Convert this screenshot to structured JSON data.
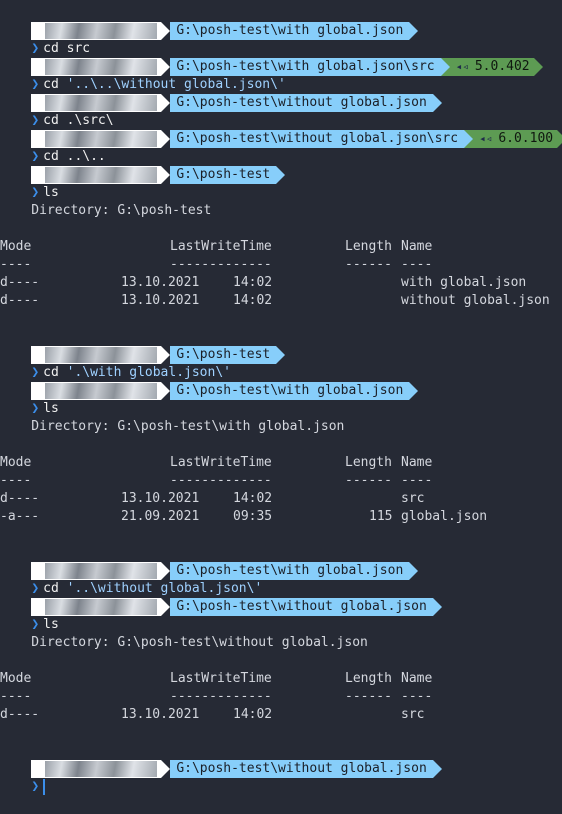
{
  "path": {
    "with_global": "G:\\posh-test\\with global.json",
    "with_global_src": "G:\\posh-test\\with global.json\\src",
    "without_global": "G:\\posh-test\\without global.json",
    "without_global_src": "G:\\posh-test\\without global.json\\src",
    "root": "G:\\posh-test"
  },
  "dotnet": {
    "v1": "5.0.402",
    "v2": "6.0.100"
  },
  "commands": {
    "c1": "cd src",
    "c2_cmd": "cd",
    "c2_arg": "'..\\..\\without global.json\\'",
    "c3": "cd .\\src\\",
    "c4": "cd ..\\..",
    "c5": "ls",
    "c6_cmd": "cd",
    "c6_arg": "'.\\with global.json\\'",
    "c7": "ls",
    "c8_cmd": "cd",
    "c8_arg": "'..\\without global.json\\'",
    "c9": "ls"
  },
  "listings": [
    {
      "directory": "    Directory: G:\\posh-test",
      "headers": {
        "mode": "Mode",
        "time": "LastWriteTime",
        "length": "Length",
        "name": "Name"
      },
      "dashes": {
        "mode": "----",
        "time": "-------------",
        "length": "------",
        "name": "----"
      },
      "rows": [
        {
          "mode": "d----",
          "date": "13.10.2021",
          "time": "14:02",
          "length": "",
          "name": "with global.json"
        },
        {
          "mode": "d----",
          "date": "13.10.2021",
          "time": "14:02",
          "length": "",
          "name": "without global.json"
        }
      ]
    },
    {
      "directory": "    Directory: G:\\posh-test\\with global.json",
      "headers": {
        "mode": "Mode",
        "time": "LastWriteTime",
        "length": "Length",
        "name": "Name"
      },
      "dashes": {
        "mode": "----",
        "time": "-------------",
        "length": "------",
        "name": "----"
      },
      "rows": [
        {
          "mode": "d----",
          "date": "13.10.2021",
          "time": "14:02",
          "length": "",
          "name": "src"
        },
        {
          "mode": "-a---",
          "date": "21.09.2021",
          "time": "09:35",
          "length": "115",
          "name": "global.json"
        }
      ]
    },
    {
      "directory": "    Directory: G:\\posh-test\\without global.json",
      "headers": {
        "mode": "Mode",
        "time": "LastWriteTime",
        "length": "Length",
        "name": "Name"
      },
      "dashes": {
        "mode": "----",
        "time": "-------------",
        "length": "------",
        "name": "----"
      },
      "rows": [
        {
          "mode": "d----",
          "date": "13.10.2021",
          "time": "14:02",
          "length": "",
          "name": "src"
        }
      ]
    }
  ],
  "icons": {
    "chevron": "❯",
    "dotnet": "◂◃"
  },
  "colors": {
    "background": "#262a35",
    "path_segment": "#87cefa",
    "dotnet_segment": "#5d9b53",
    "prompt_chevron": "#3b8eea"
  }
}
